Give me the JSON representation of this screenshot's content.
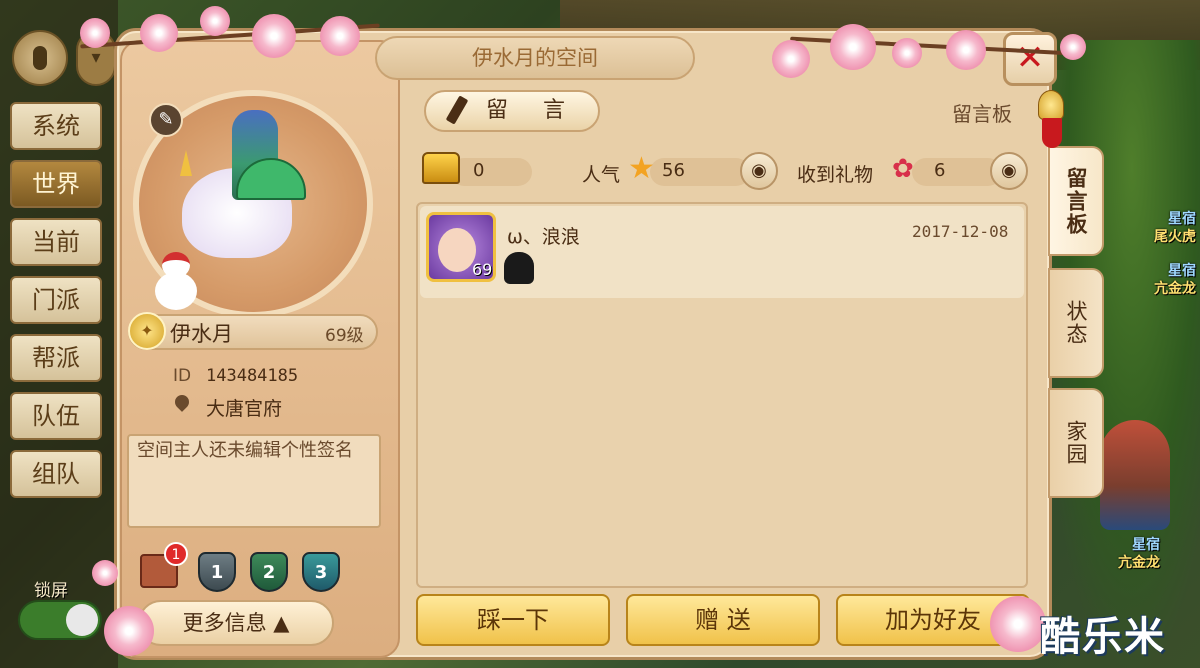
{
  "window": {
    "title": "伊水月的空间",
    "close_icon": "close-icon"
  },
  "channels": [
    {
      "label": "系统",
      "active": false
    },
    {
      "label": "世界",
      "active": true
    },
    {
      "label": "当前",
      "active": false
    },
    {
      "label": "门派",
      "active": false
    },
    {
      "label": "帮派",
      "active": false
    },
    {
      "label": "队伍",
      "active": false
    },
    {
      "label": "组队",
      "active": false
    }
  ],
  "lock_screen": {
    "label": "锁屏",
    "on": true
  },
  "profile": {
    "name": "伊水月",
    "level": "69级",
    "id_label": "ID",
    "id": "143484185",
    "location": "大唐官府",
    "signature": "空间主人还未编辑个性签名",
    "mail_badge": "1",
    "shields": [
      "1",
      "2",
      "3"
    ],
    "more_label": "更多信息"
  },
  "toolbar": {
    "leave_message_label": "留 言",
    "board_title": "留言板"
  },
  "stats": {
    "gold": "0",
    "popularity_label": "人气",
    "popularity": "56",
    "gifts_label": "收到礼物",
    "gifts": "6"
  },
  "messages": [
    {
      "name": "ω、浪浪",
      "date": "2017-12-08",
      "avatar_level": "69"
    }
  ],
  "actions": {
    "poke": "踩一下",
    "gift": "赠 送",
    "add_friend": "加为好友"
  },
  "side_tabs": [
    {
      "label": "留言板",
      "active": true
    },
    {
      "label": "状态",
      "active": false
    },
    {
      "label": "家园",
      "active": false
    }
  ],
  "background_npcs": [
    {
      "title": "星宿",
      "name": "尾火虎"
    },
    {
      "title": "星宿",
      "name": "亢金龙"
    },
    {
      "title": "星宿",
      "name": "亢金龙"
    }
  ],
  "watermark": "酷乐米",
  "colors": {
    "accent_gold": "#f0c24a",
    "close_red": "#c8191e",
    "panel_bg": "#e8cfa8"
  }
}
